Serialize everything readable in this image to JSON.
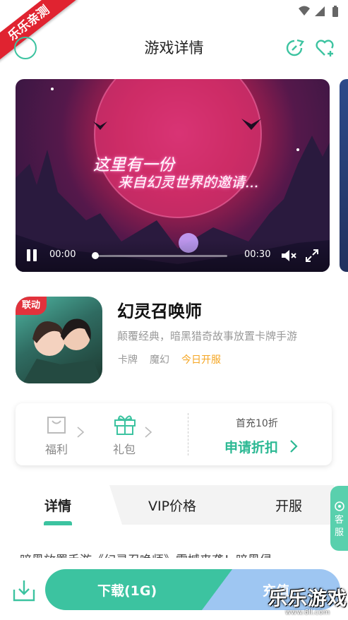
{
  "ribbon": "乐乐亲测",
  "header": {
    "title": "游戏详情"
  },
  "media": {
    "tagline_line1": "这里有一份",
    "tagline_line2": "来自幻灵世界的邀请...",
    "current_time": "00:00",
    "duration": "00:30",
    "progress": 0.0
  },
  "app": {
    "badge": "联动",
    "name": "幻灵召唤师",
    "description": "颠覆经典，暗黑猎奇故事放置卡牌手游",
    "tags": [
      "卡牌",
      "魔幻",
      "今日开服"
    ]
  },
  "benefits": {
    "welfare_label": "福利",
    "gift_label": "礼包",
    "first_recharge": "首充10折",
    "apply_discount": "申请折扣"
  },
  "tabs": [
    "详情",
    "VIP价格",
    "开服"
  ],
  "customer_service": "客服",
  "description_preview": "暗黑放置手游《幻灵召唤师》震撼来袭！暗黑侵",
  "bottom": {
    "download_label": "下载(1G)",
    "recharge_label": "充值"
  },
  "watermark": {
    "text": "乐乐游戏",
    "url": "www.6ll.com"
  },
  "colors": {
    "accent": "#3cc3a0",
    "ribbon": "#e02330",
    "tag_highlight": "#f5a623",
    "recharge": "#9ec6f2"
  }
}
